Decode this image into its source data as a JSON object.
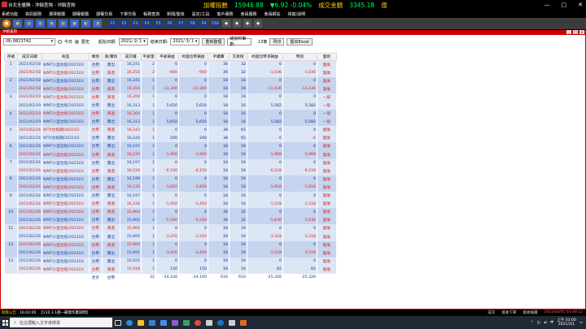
{
  "app": {
    "title": "台北全壘勝 - 沖銷查詢 - 沖銷查詢",
    "ticker_label1": "加權指數",
    "ticker_index": "15946.88",
    "ticker_change": "▼6.92 -0.04%",
    "ticker_label2": "成交金額",
    "ticker_amount": "3345.18",
    "ticker_unit": "億"
  },
  "menu": [
    "系統功能",
    "資訊服務",
    "選擇報價",
    "期權報價",
    "期權交易",
    "下單交易",
    "帳務查詢",
    "新聞/盤後",
    "設定/工具",
    "客戶服務",
    "會員服務",
    "會員網站",
    "視窗/說明"
  ],
  "toolbar": {
    "fkeys": [
      "F1",
      "F2",
      "F3",
      "F4",
      "F5",
      "F6",
      "F7",
      "F8",
      "F9",
      "F10"
    ]
  },
  "panel": {
    "title": "沖銷查詢"
  },
  "filters": {
    "account": "(B)  8823742",
    "today_label": "今日",
    "history_label": "歷史",
    "start_label": "起始日期:",
    "start_date": "2021/ 2/ 1",
    "end_label": "結束日期:",
    "end_date": "2021/ 3/ 1",
    "refresh_btn": "重新整理",
    "count_label": "總資料筆數:",
    "count": "13筆",
    "print_btn": "列印",
    "export_btn": "匯出Excel"
  },
  "table": {
    "headers": [
      "序號",
      "成交日期",
      "商品",
      "類別",
      "買/賣別",
      "成交價",
      "平倉量",
      "平倉損益",
      "約當台幣損益",
      "手續費",
      "交易稅",
      "約當台幣淨損益",
      "幣別",
      "盤別"
    ],
    "rows": [
      [
        "1",
        "2021/02/18",
        "WMT小型台指/202103",
        "台幣",
        "賣出",
        "16,241",
        "2",
        "0",
        "0",
        "36",
        "32",
        "0",
        "0",
        "盤後"
      ],
      [
        "",
        "2021/02/18",
        "WMT小型台指/202103",
        "台幣",
        "買進",
        "16,250",
        "2",
        "-900",
        "-900",
        "36",
        "32",
        "-1,036",
        "-1,036",
        "盤後"
      ],
      [
        "2",
        "2021/02/18",
        "WMT小型台指/202103",
        "台幣",
        "賣出",
        "16,241",
        "1",
        "0",
        "0",
        "18",
        "16",
        "0",
        "0",
        "盤後"
      ],
      [
        "",
        "2021/02/18",
        "WMT小型台指/202103",
        "台幣",
        "買進",
        "16,354",
        "1",
        "-11,300",
        "-11,300",
        "18",
        "16",
        "-11,436",
        "-11,436",
        "盤後"
      ],
      [
        "3",
        "2021/02/19",
        "WMT小型台指/202103",
        "台幣",
        "買進",
        "16,200",
        "1",
        "0",
        "0",
        "18",
        "16",
        "0",
        "0",
        "一般"
      ],
      [
        "",
        "2021/02/19",
        "WMT小型台指/202103",
        "台幣",
        "賣出",
        "16,313",
        "1",
        "5,650",
        "5,650",
        "18",
        "16",
        "5,582",
        "5,582",
        "一般"
      ],
      [
        "4",
        "2021/02/19",
        "WMT小型台指/202103",
        "台幣",
        "買進",
        "16,200",
        "1",
        "0",
        "0",
        "18",
        "16",
        "0",
        "0",
        "一般"
      ],
      [
        "",
        "2021/02/19",
        "WMT小型台指/202103",
        "台幣",
        "賣出",
        "16,313",
        "1",
        "5,650",
        "5,650",
        "18",
        "16",
        "5,582",
        "5,582",
        "一般"
      ],
      [
        "5",
        "2021/02/24",
        "WTX台指期/202103",
        "台幣",
        "買進",
        "16,243",
        "1",
        "0",
        "0",
        "38",
        "65",
        "0",
        "0",
        "盤後"
      ],
      [
        "",
        "2021/02/24",
        "WTX台指期/202103",
        "台幣",
        "賣出",
        "16,244",
        "1",
        "200",
        "200",
        "38",
        "65",
        "-6",
        "-6",
        "盤後"
      ],
      [
        "6",
        "2021/02/24",
        "WMT小型台指/202103",
        "台幣",
        "賣出",
        "16,197",
        "1",
        "0",
        "0",
        "18",
        "16",
        "0",
        "0",
        "盤後"
      ],
      [
        "",
        "2021/02/24",
        "WMT小型台指/202103",
        "台幣",
        "買進",
        "16,235",
        "1",
        "-1,900",
        "-1,900",
        "18",
        "16",
        "-1,968",
        "-1,968",
        "盤後"
      ],
      [
        "7",
        "2021/02/24",
        "WMT小型台指/202103",
        "台幣",
        "賣出",
        "16,197",
        "1",
        "0",
        "0",
        "18",
        "16",
        "0",
        "0",
        "盤後"
      ],
      [
        "",
        "2021/02/24",
        "WMT小型台指/202103",
        "台幣",
        "買進",
        "16,520",
        "1",
        "-6,150",
        "-6,150",
        "18",
        "16",
        "-6,218",
        "-6,218",
        "盤後"
      ],
      [
        "8",
        "2021/02/24",
        "WMT小型台指/202103",
        "台幣",
        "賣出",
        "16,198",
        "1",
        "0",
        "0",
        "18",
        "16",
        "0",
        "0",
        "盤後"
      ],
      [
        "",
        "2021/02/24",
        "WMT小型台指/202103",
        "台幣",
        "買進",
        "16,235",
        "1",
        "-1,850",
        "-1,850",
        "18",
        "16",
        "-1,918",
        "-1,918",
        "盤後"
      ],
      [
        "9",
        "2021/02/24",
        "WMT小型台指/202103",
        "台幣",
        "賣出",
        "16,197",
        "1",
        "0",
        "0",
        "18",
        "16",
        "0",
        "0",
        "盤後"
      ],
      [
        "",
        "2021/02/24",
        "WMT小型台指/202103",
        "台幣",
        "買進",
        "16,226",
        "1",
        "-1,450",
        "-1,450",
        "18",
        "16",
        "-1,518",
        "-1,518",
        "盤後"
      ],
      [
        "10",
        "2021/02/26",
        "WMT小型台指/202103",
        "台幣",
        "買進",
        "15,960",
        "2",
        "0",
        "0",
        "36",
        "32",
        "0",
        "0",
        "盤後"
      ],
      [
        "",
        "2021/02/26",
        "WMT小型台指/202103",
        "台幣",
        "賣出",
        "15,905",
        "2",
        "-5,500",
        "-5,500",
        "36",
        "32",
        "-5,636",
        "-5,636",
        "盤後"
      ],
      [
        "11",
        "2021/02/26",
        "WMT小型台指/202103",
        "台幣",
        "買進",
        "15,960",
        "1",
        "0",
        "0",
        "18",
        "16",
        "0",
        "0",
        "盤後"
      ],
      [
        "",
        "2021/02/26",
        "WMT小型台指/202103",
        "台幣",
        "賣出",
        "15,895",
        "1",
        "-3,250",
        "-3,250",
        "18",
        "16",
        "-3,318",
        "-3,318",
        "盤後"
      ],
      [
        "12",
        "2021/02/26",
        "WMT小型台指/202103",
        "台幣",
        "買進",
        "15,960",
        "1",
        "0",
        "0",
        "18",
        "16",
        "0",
        "0",
        "盤後"
      ],
      [
        "",
        "2021/02/26",
        "WMT小型台指/202103",
        "台幣",
        "賣出",
        "15,891",
        "1",
        "-3,450",
        "-3,450",
        "18",
        "16",
        "-3,518",
        "-3,518",
        "盤後"
      ],
      [
        "13",
        "2021/02/26",
        "WMT小型台指/202103",
        "台幣",
        "賣出",
        "15,921",
        "1",
        "0",
        "0",
        "18",
        "16",
        "0",
        "0",
        "盤後"
      ],
      [
        "",
        "2021/02/26",
        "WMT小型台指/202103",
        "台幣",
        "買進",
        "15,918",
        "1",
        "150",
        "150",
        "18",
        "16",
        "82",
        "82",
        "盤後"
      ]
    ],
    "total": [
      "",
      "",
      "",
      "合計",
      "台幣",
      "",
      "32",
      "-24,100",
      "-24,100",
      "616",
      "610",
      "-25,326",
      "-25,326",
      ""
    ]
  },
  "status": {
    "left": "期貨公告",
    "time": "16:02:00",
    "info": "【110.3.1週一補發作業說明】",
    "r1": "成交",
    "r2": "接收下單",
    "r3": "接收報價",
    "datetime": "2021/03/01 03:00:12"
  },
  "taskbar": {
    "search_placeholder": "在這裡輸入文字來搜尋",
    "clock_time": "上午 03:00",
    "clock_date": "2021/3/1"
  },
  "colors": {
    "row_light": "#dde6f5",
    "row_dark": "#c5d4ef",
    "panel_border": "#cc0000",
    "negative": "#d02020"
  }
}
